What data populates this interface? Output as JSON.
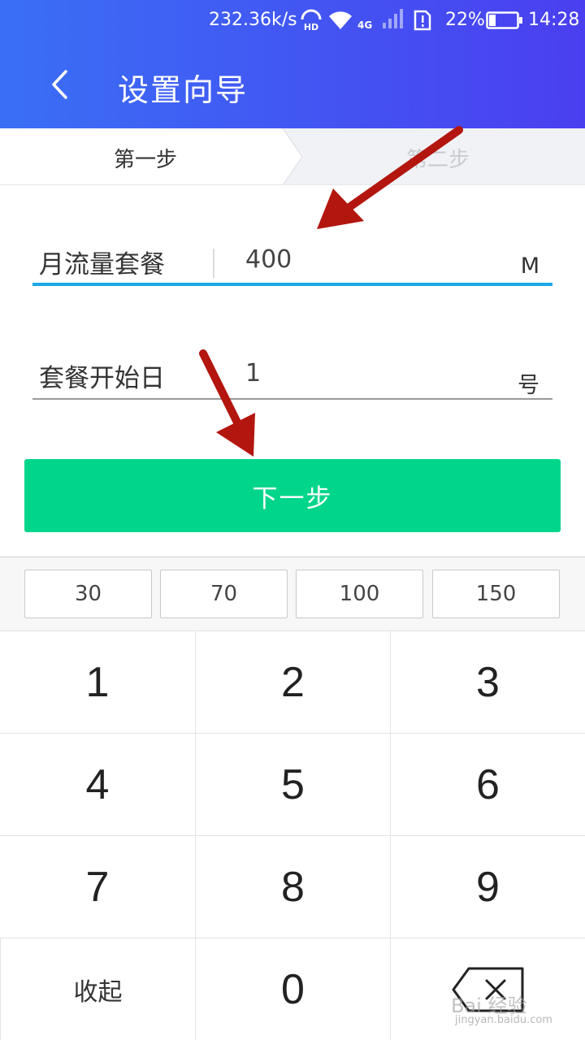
{
  "status_bar": {
    "speed": "232.36k/s",
    "hd": "HD",
    "network": "4G",
    "battery": "22%",
    "time": "14:28"
  },
  "header": {
    "title": "设置向导"
  },
  "steps": [
    {
      "label": "第一步",
      "active": true
    },
    {
      "label": "第二步",
      "active": false
    }
  ],
  "form": {
    "plan_label": "月流量套餐",
    "plan_value": "400",
    "plan_unit": "M",
    "start_label": "套餐开始日",
    "start_value": "1",
    "start_unit": "号"
  },
  "next_button": "下一步",
  "quick_values": [
    "30",
    "70",
    "100",
    "150"
  ],
  "keypad": {
    "keys": [
      "1",
      "2",
      "3",
      "4",
      "5",
      "6",
      "7",
      "8",
      "9"
    ],
    "collapse": "收起",
    "zero": "0"
  },
  "watermark": {
    "text": "Bai 经验",
    "url": "jingyan.baidu.com"
  },
  "colors": {
    "header_start": "#3a6ff5",
    "header_end": "#4a3ff0",
    "accent_underline": "#1aa8e8",
    "button_green": "#00d68b",
    "annotation_arrow": "#b3160f"
  }
}
